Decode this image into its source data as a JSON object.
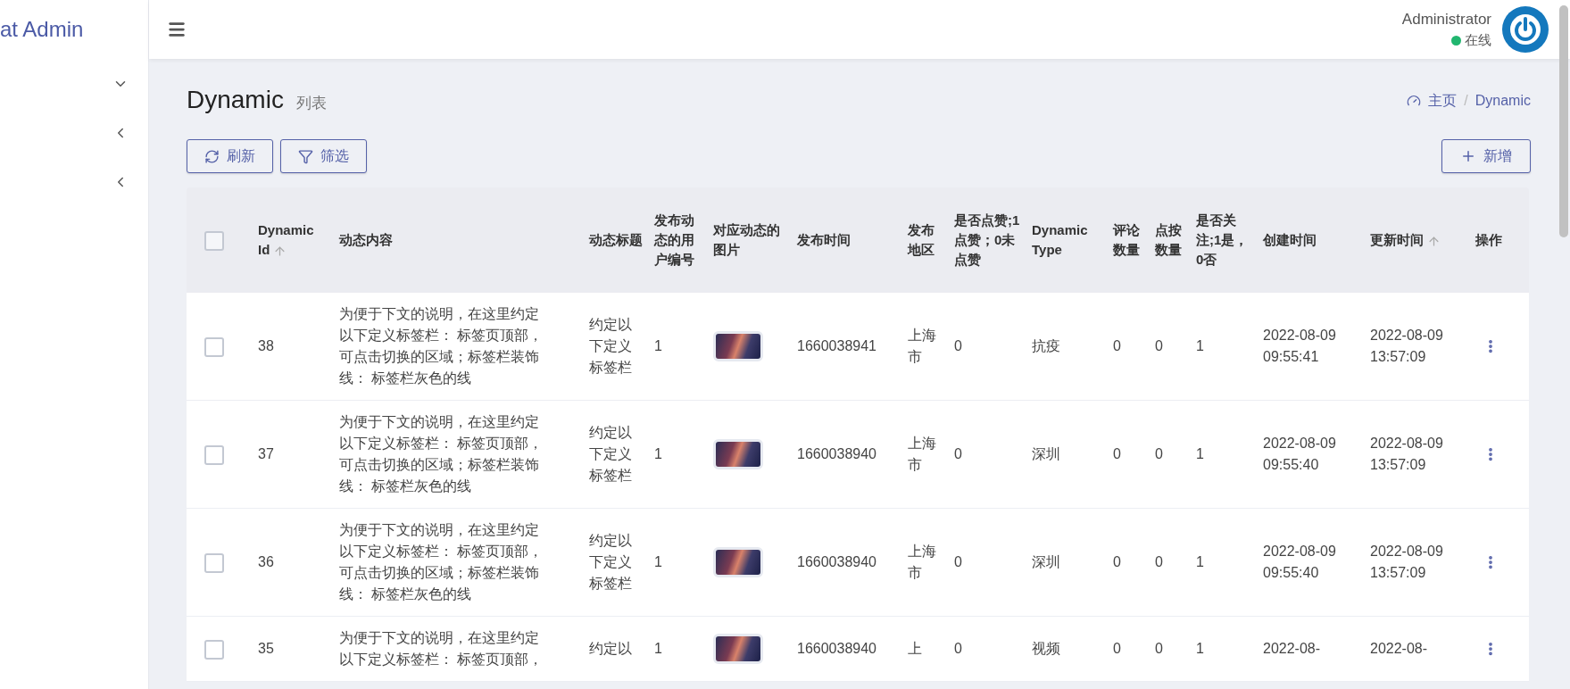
{
  "sidebar": {
    "brand": "at Admin",
    "menu": [
      {
        "expanded": true
      },
      {
        "expanded": false
      },
      {
        "expanded": false
      }
    ]
  },
  "header": {
    "user": {
      "name": "Administrator",
      "status": "在线"
    }
  },
  "page": {
    "title": "Dynamic",
    "subtitle": "列表",
    "breadcrumb": [
      {
        "label": "主页",
        "kind": "home"
      },
      {
        "label": "/",
        "kind": "separator"
      },
      {
        "label": "Dynamic",
        "kind": "current"
      }
    ]
  },
  "toolbar": {
    "buttons": [
      {
        "label": "刷新",
        "kind": "refresh"
      },
      {
        "label": "筛选",
        "kind": "filter"
      }
    ],
    "add_button": {
      "label": "新增"
    }
  },
  "table": {
    "select_all": {
      "checked": false
    },
    "columns": [
      {
        "label": "Dynamic Id",
        "sortable": true
      },
      {
        "label": "动态内容",
        "sortable": false
      },
      {
        "label": "动态标题",
        "sortable": false
      },
      {
        "label": "发布动态的用户编号",
        "sortable": false
      },
      {
        "label": "对应动态的图片",
        "sortable": false
      },
      {
        "label": "发布时间",
        "sortable": false
      },
      {
        "label": "发布地区",
        "sortable": false
      },
      {
        "label": "是否点赞;1点赞；0未点赞",
        "sortable": false
      },
      {
        "label": "Dynamic Type",
        "sortable": false
      },
      {
        "label": "评论数量",
        "sortable": false
      },
      {
        "label": "点按数量",
        "sortable": false
      },
      {
        "label": "是否关注;1是，0否",
        "sortable": false
      },
      {
        "label": "创建时间",
        "sortable": false
      },
      {
        "label": "更新时间",
        "sortable": true
      },
      {
        "label": "操作",
        "sortable": false
      }
    ],
    "rows": [
      {
        "selected": false,
        "id": "38",
        "content": "为便于下文的说明，在这里约定以下定义标签栏： 标签页顶部，可点击切换的区域；标签栏装饰线： 标签栏灰色的线",
        "title": "约定以下定义标签栏",
        "user_id": "1",
        "time": "1660038941",
        "region": "上海市",
        "liked": "0",
        "type": "抗疫",
        "comments": "0",
        "clicks": "0",
        "follow": "1",
        "created": "2022-08-09 09:55:41",
        "updated": "2022-08-09 13:57:09"
      },
      {
        "selected": false,
        "id": "37",
        "content": "为便于下文的说明，在这里约定以下定义标签栏： 标签页顶部，可点击切换的区域；标签栏装饰线： 标签栏灰色的线",
        "title": "约定以下定义标签栏",
        "user_id": "1",
        "time": "1660038940",
        "region": "上海市",
        "liked": "0",
        "type": "深圳",
        "comments": "0",
        "clicks": "0",
        "follow": "1",
        "created": "2022-08-09 09:55:40",
        "updated": "2022-08-09 13:57:09"
      },
      {
        "selected": false,
        "id": "36",
        "content": "为便于下文的说明，在这里约定以下定义标签栏： 标签页顶部，可点击切换的区域；标签栏装饰线： 标签栏灰色的线",
        "title": "约定以下定义标签栏",
        "user_id": "1",
        "time": "1660038940",
        "region": "上海市",
        "liked": "0",
        "type": "深圳",
        "comments": "0",
        "clicks": "0",
        "follow": "1",
        "created": "2022-08-09 09:55:40",
        "updated": "2022-08-09 13:57:09"
      },
      {
        "selected": false,
        "id": "35",
        "content": "为便于下文的说明，在这里约定以下定义标签栏： 标签页顶部，",
        "title": "约定以",
        "user_id": "1",
        "time": "1660038940",
        "region": "上",
        "liked": "0",
        "type": "视频",
        "comments": "0",
        "clicks": "0",
        "follow": "1",
        "created": "2022-08-",
        "updated": "2022-08-"
      }
    ]
  }
}
